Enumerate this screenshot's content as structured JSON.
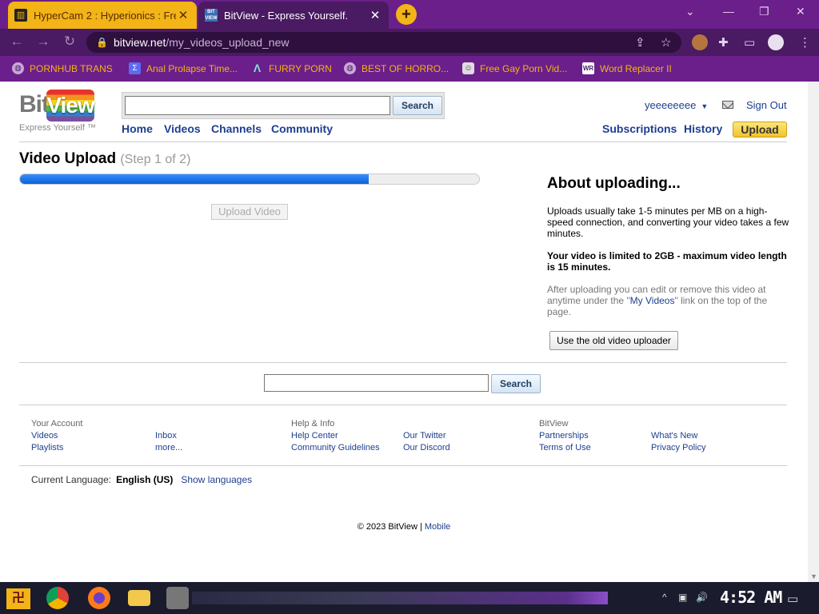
{
  "browser": {
    "tabs": [
      {
        "title": "HyperCam 2 : Hyperionics : Fre",
        "active": false
      },
      {
        "title": "BitView - Express Yourself.",
        "active": true
      }
    ],
    "new_tab": "+",
    "url_domain": "bitview.net",
    "url_path": "/my_videos_upload_new",
    "bookmarks": [
      "PORNHUB TRANS",
      "Anal Prolapse Time...",
      "FURRY PORN",
      "BEST OF HORRO...",
      "Free Gay Porn Vid...",
      "Word Replacer II"
    ]
  },
  "site": {
    "logo_bit": "Bit",
    "logo_view": "View",
    "slogan": "Express Yourself ™",
    "search_button": "Search",
    "nav": [
      "Home",
      "Videos",
      "Channels",
      "Community"
    ],
    "username": "yeeeeeeee",
    "sign_out": "Sign Out",
    "subscriptions": "Subscriptions",
    "history": "History",
    "upload": "Upload"
  },
  "upload": {
    "title": "Video Upload",
    "step": "(Step 1 of 2)",
    "progress_fraction": 0.76,
    "button": "Upload Video"
  },
  "about": {
    "heading": "About uploading...",
    "p1": "Uploads usually take 1-5 minutes per MB on a high-speed connection, and converting your video takes a few minutes.",
    "p2": "Your video is limited to 2GB - maximum video length is 15 minutes.",
    "p3_before": "After uploading you can edit or remove this video at anytime under the \"",
    "p3_link": "My Videos",
    "p3_after": "\" link on the top of the page.",
    "old_uploader": "Use the old video uploader"
  },
  "bottom_search": {
    "button": "Search"
  },
  "footer": {
    "your_account": "Your Account",
    "videos": "Videos",
    "playlists": "Playlists",
    "inbox": "Inbox",
    "more": "more...",
    "help_info": "Help & Info",
    "help_center": "Help Center",
    "community_guidelines": "Community Guidelines",
    "our_twitter": "Our Twitter",
    "our_discord": "Our Discord",
    "bitview": "BitView",
    "partnerships": "Partnerships",
    "terms": "Terms of Use",
    "whats_new": "What's New",
    "privacy": "Privacy Policy",
    "current_language_label": "Current Language:",
    "current_language": "English (US)",
    "show_languages": "Show languages",
    "copyright": "© 2023 BitView",
    "separator": "|",
    "mobile": "Mobile"
  },
  "taskbar": {
    "clock": "4:52 AM"
  }
}
